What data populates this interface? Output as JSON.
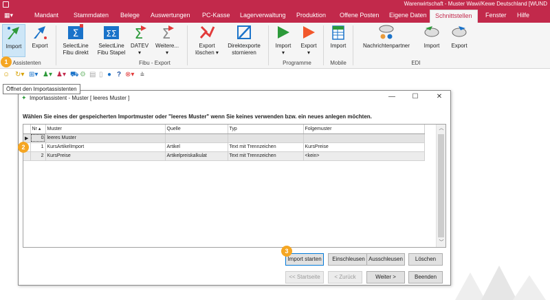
{
  "window_title": "Warenwirtschaft - Muster Wawi/Kewe Deutschland [WUND",
  "menu": {
    "items": [
      {
        "label": "Mandant"
      },
      {
        "label": "Stammdaten"
      },
      {
        "label": "Belege"
      },
      {
        "label": "Auswertungen"
      },
      {
        "label": "PC-Kasse"
      },
      {
        "label": "Lagerverwaltung"
      },
      {
        "label": "Produktion"
      },
      {
        "label": "Offene Posten"
      },
      {
        "label": "Eigene Daten"
      },
      {
        "label": "Schnittstellen"
      },
      {
        "label": "Fenster"
      },
      {
        "label": "Hilfe"
      }
    ],
    "active": "Schnittstellen"
  },
  "ribbon": {
    "assistenten": {
      "label": "Assistenten",
      "import": "Import",
      "export": "Export"
    },
    "fibu": {
      "label": "Fibu - Export",
      "selectline_direkt_1": "SelectLine",
      "selectline_direkt_2": "Fibu direkt",
      "selectline_stapel_1": "SelectLine",
      "selectline_stapel_2": "Fibu Stapel",
      "datev": "DATEV",
      "weitere": "Weitere..."
    },
    "export_loeschen_1": "Export",
    "export_loeschen_2": "löschen",
    "direktexporte_1": "Direktexporte",
    "direktexporte_2": "stornieren",
    "programme": {
      "label": "Programme",
      "import": "Import",
      "export": "Export"
    },
    "mobile": {
      "label": "Mobile",
      "import": "Import"
    },
    "edi": {
      "label": "EDI",
      "nachrichtenpartner": "Nachrichtenpartner",
      "import": "Import",
      "export": "Export"
    }
  },
  "tooltip": "Öffnet den Importassistenten",
  "badges": [
    "1",
    "2",
    "3"
  ],
  "dialog": {
    "title": "Importassistent - Muster [ leeres Muster ]",
    "instruction": "Wählen Sie eines der gespeicherten Importmuster oder \"leeres Muster\" wenn Sie keines verwenden bzw. ein neues anlegen möchten.",
    "columns": [
      "Nr",
      "Muster",
      "Quelle",
      "Typ",
      "Folgemuster"
    ],
    "rows": [
      {
        "nr": "0",
        "muster": "leeres Muster",
        "quelle": "",
        "typ": "",
        "folgemuster": ""
      },
      {
        "nr": "1",
        "muster": "KursArtikelImport",
        "quelle": "Artikel",
        "typ": "Text mit Trennzeichen",
        "folgemuster": "KursPreise"
      },
      {
        "nr": "2",
        "muster": "KursPreise",
        "quelle": "Artikelpreiskalkulat",
        "typ": "Text mit Trennzeichen",
        "folgemuster": "<kein>"
      }
    ],
    "buttons_row1": {
      "import_starten": "Import starten",
      "einschleusen": "Einschleusen",
      "ausschleusen": "Ausschleusen",
      "loeschen": "Löschen"
    },
    "buttons_row2": {
      "startseite": "<< Startseite",
      "zurueck": "< Zurück",
      "weiter": "Weiter >",
      "beenden": "Beenden"
    }
  },
  "colors": {
    "accent": "#c2294b",
    "badge": "#f5a623"
  }
}
